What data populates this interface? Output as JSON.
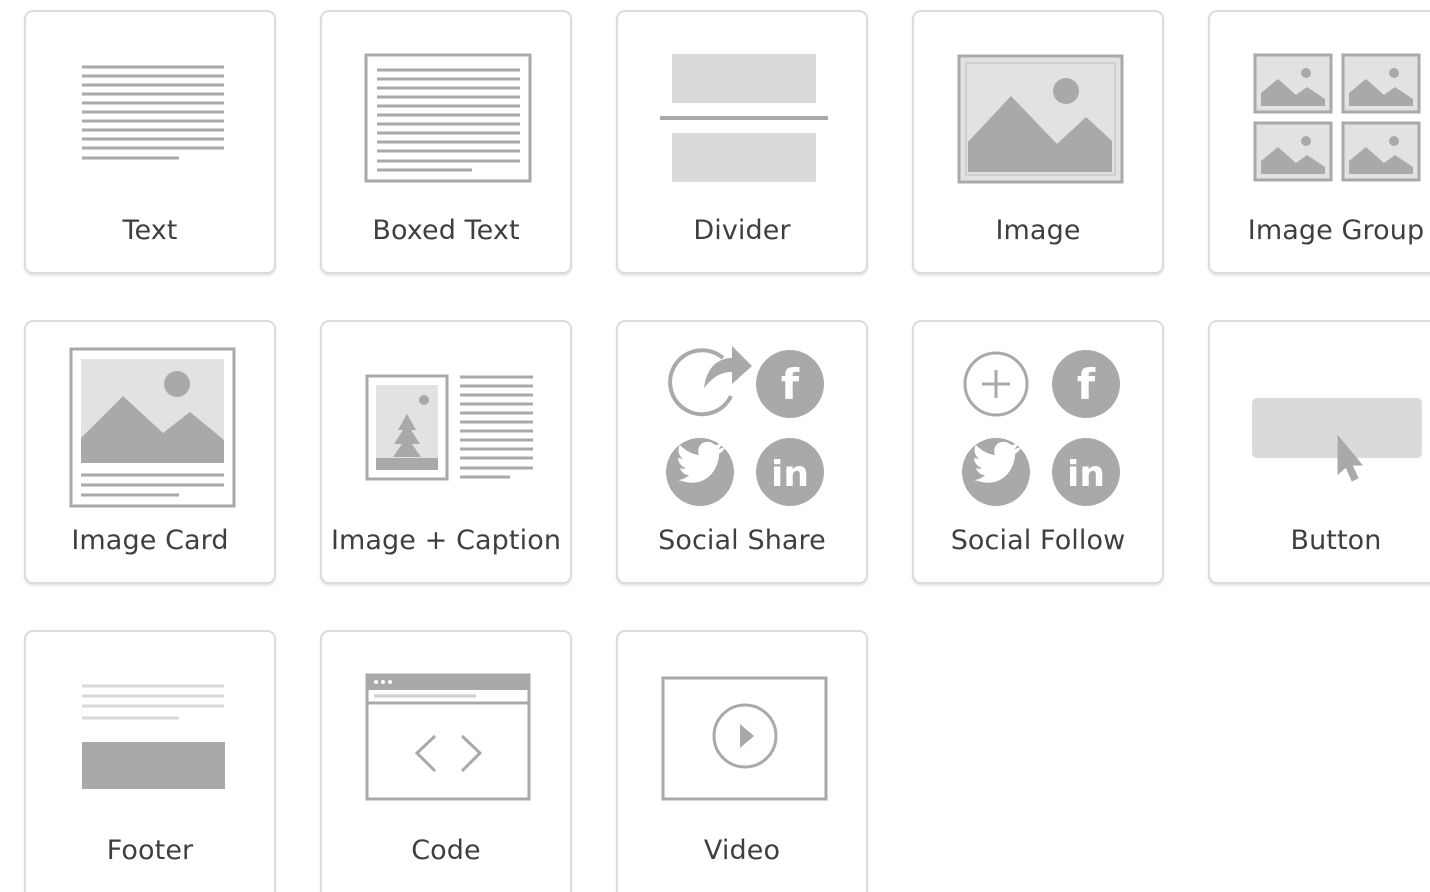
{
  "blocks": [
    {
      "key": "text",
      "label": "Text",
      "icon": "text-lines-icon"
    },
    {
      "key": "boxed_text",
      "label": "Boxed Text",
      "icon": "boxed-text-icon"
    },
    {
      "key": "divider",
      "label": "Divider",
      "icon": "divider-icon"
    },
    {
      "key": "image",
      "label": "Image",
      "icon": "image-icon"
    },
    {
      "key": "image_group",
      "label": "Image Group",
      "icon": "image-group-icon"
    },
    {
      "key": "image_card",
      "label": "Image Card",
      "icon": "image-card-icon"
    },
    {
      "key": "image_caption",
      "label": "Image + Caption",
      "icon": "image-caption-icon"
    },
    {
      "key": "social_share",
      "label": "Social Share",
      "icon": "social-share-icon"
    },
    {
      "key": "social_follow",
      "label": "Social Follow",
      "icon": "social-follow-icon"
    },
    {
      "key": "button",
      "label": "Button",
      "icon": "button-cursor-icon"
    },
    {
      "key": "footer",
      "label": "Footer",
      "icon": "footer-icon"
    },
    {
      "key": "code",
      "label": "Code",
      "icon": "code-window-icon"
    },
    {
      "key": "video",
      "label": "Video",
      "icon": "video-play-icon"
    }
  ],
  "colors": {
    "tile_border": "#dcdcdc",
    "icon_gray": "#a9a9a9",
    "icon_light": "#dadada",
    "label_text": "#3f3f3f"
  }
}
